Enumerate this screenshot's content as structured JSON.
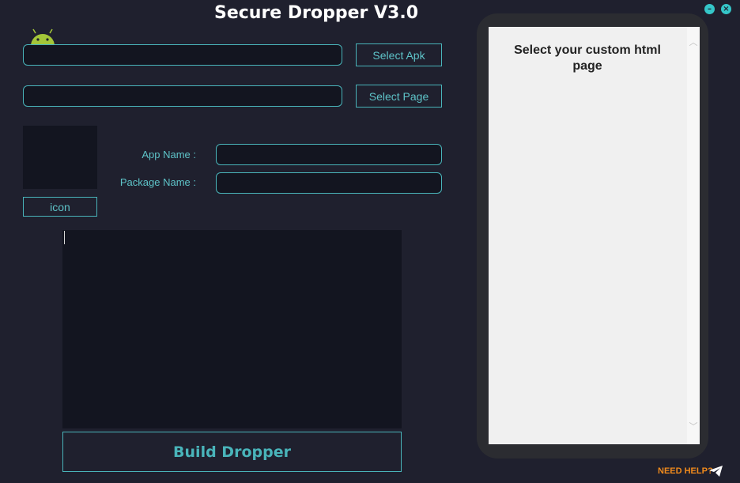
{
  "app": {
    "title": "Secure Dropper V3.0"
  },
  "window_controls": {
    "minimize_icon": "minus-icon",
    "close_icon": "close-icon"
  },
  "apk": {
    "path_value": "",
    "button_label": "Select Apk"
  },
  "page": {
    "path_value": "",
    "button_label": "Select Page"
  },
  "icon_section": {
    "button_label": "icon"
  },
  "fields": {
    "app_name_label": "App Name :",
    "app_name_value": "",
    "package_name_label": "Package Name :",
    "package_name_value": ""
  },
  "log": {
    "text": ""
  },
  "build_button_label": "Build Dropper",
  "preview": {
    "text": "Select your custom html page"
  },
  "help": {
    "label": "NEED HELP?",
    "icon": "telegram-send-icon"
  },
  "colors": {
    "background": "#1f202e",
    "field": "#131520",
    "accent": "#49b4ba",
    "help": "#f08a1c",
    "phone_frame": "#2b2c31",
    "preview_screen": "#f0f0f0"
  }
}
